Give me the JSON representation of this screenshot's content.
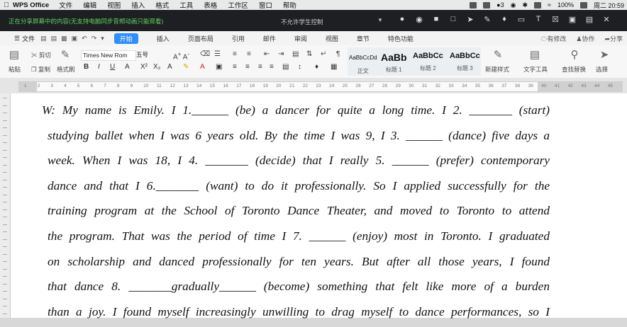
{
  "menubar": {
    "app_name": "WPS Office",
    "items": [
      "文件",
      "编辑",
      "视图",
      "插入",
      "格式",
      "工具",
      "表格",
      "工作区",
      "窗口",
      "帮助"
    ],
    "wechat_count": "3",
    "battery": "100%",
    "clock": "周二 20:59"
  },
  "titlebar": {
    "notice": "正在分享屏幕中的内容(无支持电脑同步音频动画只能观看)",
    "doc_title": "不允许学生控制"
  },
  "ribbon_tabs": {
    "file": "文件",
    "tabs": [
      "开始",
      "插入",
      "页面布局",
      "引用",
      "邮件",
      "审阅",
      "视图",
      "章节",
      "特色功能"
    ],
    "active": "开始",
    "unsaved": "有修改",
    "collab": "协作",
    "share": "分享"
  },
  "ribbon": {
    "paste": "粘贴",
    "cut": "剪切",
    "copy": "复制",
    "format_painter": "格式刷",
    "font_name": "Times New Rom",
    "font_size": "五号",
    "styles": [
      {
        "sample": "AaBbCcDd",
        "caption": "正文"
      },
      {
        "sample": "AaBb",
        "caption": "标题 1"
      },
      {
        "sample": "AaBbCc",
        "caption": "标题 2"
      },
      {
        "sample": "AaBbCc",
        "caption": "标题 3"
      }
    ],
    "new_style": "新建样式",
    "text_tool": "文字工具",
    "find_replace": "查找替换",
    "select": "选择"
  },
  "ruler_numbers": [
    "1",
    "2",
    "3",
    "4",
    "5",
    "6",
    "7",
    "8",
    "9",
    "10",
    "11",
    "12",
    "13",
    "14",
    "15",
    "16",
    "17",
    "18",
    "19",
    "20",
    "21",
    "22",
    "23",
    "24",
    "25",
    "26",
    "27",
    "28",
    "29",
    "30",
    "31",
    "32",
    "33",
    "34",
    "35",
    "36",
    "37",
    "38",
    "39",
    "40",
    "41",
    "42",
    "43",
    "44",
    "45"
  ],
  "document": {
    "lines": [
      "W: My name is Emily. I 1.______ (be) a dancer for quite a long time. I 2. _______ (start)",
      "studying ballet when I was 6 years old. By the time I was 9, I 3. ______ (dance) five days a",
      "week. When I was 18, I 4. _______ (decide) that I really 5. ______ (prefer) contemporary",
      "dance and that I 6._______ (want) to do it professionally. So I applied successfully for the",
      "training program at the School of Toronto Dance Theater, and moved to Toronto to attend",
      "the program. That was the period of time I 7. ______ (enjoy) most in Toronto. I graduated",
      "on scholarship and danced professionally for ten years. But after all those years, I found",
      "that dance 8. _______gradually______ (become) something that felt like more of a burden",
      "than a joy. I found myself increasingly unwilling to drag myself to dance performances, so I"
    ]
  }
}
